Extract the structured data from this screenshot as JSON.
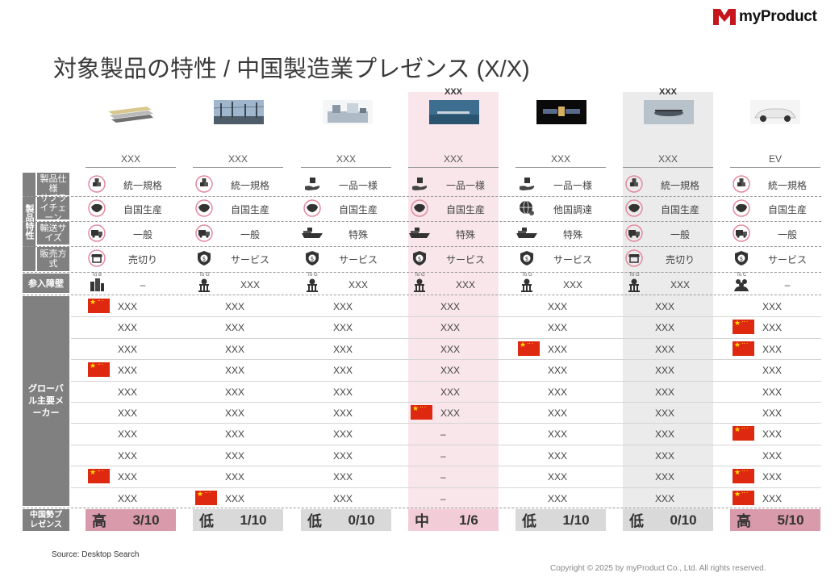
{
  "brand": {
    "name": "myProduct",
    "color": "#c4161c"
  },
  "title": "対象製品の特性 / 中国製造業プレゼンス (X/X)",
  "highlight_labels": [
    "XXX",
    "XXX"
  ],
  "columns": [
    {
      "header": "XXX",
      "spec": "統一規格",
      "supply": "自国生産",
      "transport": "一般",
      "sales": "売切り",
      "barrier_tag": "To B",
      "barrier": "–",
      "presence_level": "高",
      "presence_count": "3/10"
    },
    {
      "header": "XXX",
      "spec": "統一規格",
      "supply": "自国生産",
      "transport": "一般",
      "sales": "サービス",
      "barrier_tag": "To G",
      "barrier": "XXX",
      "presence_level": "低",
      "presence_count": "1/10"
    },
    {
      "header": "XXX",
      "spec": "一品一様",
      "supply": "自国生産",
      "transport": "特殊",
      "sales": "サービス",
      "barrier_tag": "To G",
      "barrier": "XXX",
      "presence_level": "低",
      "presence_count": "0/10"
    },
    {
      "header": "XXX",
      "spec": "一品一様",
      "supply": "自国生産",
      "transport": "特殊",
      "sales": "サービス",
      "barrier_tag": "To G",
      "barrier": "XXX",
      "presence_level": "中",
      "presence_count": "1/6"
    },
    {
      "header": "XXX",
      "spec": "一品一様",
      "supply": "他国調達",
      "transport": "特殊",
      "sales": "サービス",
      "barrier_tag": "To G",
      "barrier": "XXX",
      "presence_level": "低",
      "presence_count": "1/10"
    },
    {
      "header": "XXX",
      "spec": "統一規格",
      "supply": "自国生産",
      "transport": "一般",
      "sales": "売切り",
      "barrier_tag": "To G",
      "barrier": "XXX",
      "presence_level": "低",
      "presence_count": "0/10"
    },
    {
      "header": "EV",
      "spec": "統一規格",
      "supply": "自国生産",
      "transport": "一般",
      "sales": "サービス",
      "barrier_tag": "To C",
      "barrier": "–",
      "presence_level": "高",
      "presence_count": "5/10"
    }
  ],
  "row_labels": {
    "group_product": "製品特性",
    "spec": "製品仕様",
    "supply": "サプライチェーン",
    "transport": "輸送サイズ",
    "sales": "販売方式",
    "barrier": "参入障壁",
    "makers": "グローバル主要メーカー",
    "presence": "中国勢プレゼンス"
  },
  "makers": [
    [
      "XXX",
      "XXX",
      "XXX",
      "XXX",
      "XXX",
      "XXX",
      "XXX",
      "XXX",
      "XXX",
      "XXX"
    ],
    [
      "XXX",
      "XXX",
      "XXX",
      "XXX",
      "XXX",
      "XXX",
      "XXX",
      "XXX",
      "XXX",
      "XXX"
    ],
    [
      "XXX",
      "XXX",
      "XXX",
      "XXX",
      "XXX",
      "XXX",
      "XXX",
      "XXX",
      "XXX",
      "XXX"
    ],
    [
      "XXX",
      "XXX",
      "XXX",
      "XXX",
      "XXX",
      "XXX",
      "–",
      "–",
      "–",
      "–"
    ],
    [
      "XXX",
      "XXX",
      "XXX",
      "XXX",
      "XXX",
      "XXX",
      "XXX",
      "XXX",
      "XXX",
      "XXX"
    ],
    [
      "XXX",
      "XXX",
      "XXX",
      "XXX",
      "XXX",
      "XXX",
      "XXX",
      "XXX",
      "XXX",
      "XXX"
    ],
    [
      "XXX",
      "XXX",
      "XXX",
      "XXX",
      "XXX",
      "XXX",
      "XXX",
      "XXX",
      "XXX",
      "XXX"
    ]
  ],
  "chinese_flags": [
    [
      0,
      3,
      8
    ],
    [
      9
    ],
    [],
    [
      5
    ],
    [
      2
    ],
    [],
    [
      1,
      2,
      6,
      8,
      9
    ]
  ],
  "colors": {
    "china_red": "#de2910",
    "presence_high": "#d99aab",
    "presence_mid": "#f2ccd7",
    "presence_low": "#d9d9d9",
    "highlight_pink": "#f9e6eb",
    "highlight_gray": "#ebebeb"
  },
  "source": "Source: Desktop Search",
  "copyright": "Copyright © 2025 by myProduct Co., Ltd.  All rights reserved."
}
